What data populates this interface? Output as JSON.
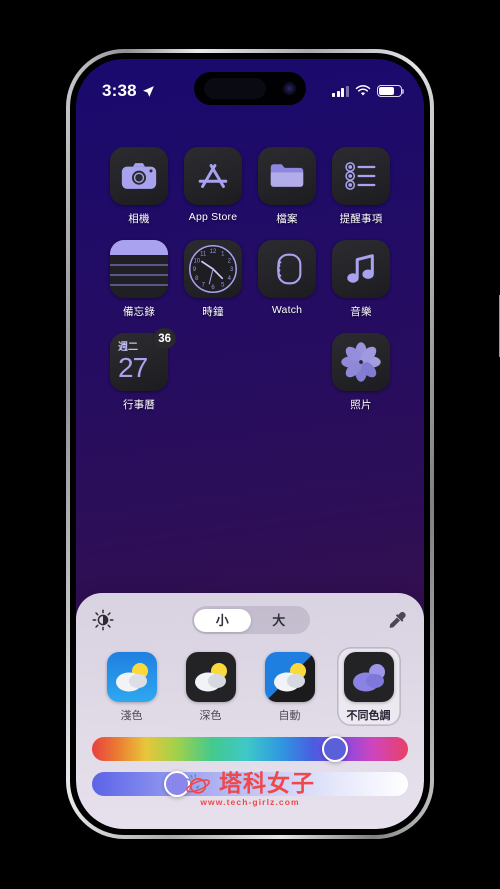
{
  "status_bar": {
    "time": "3:38",
    "location_icon": "location-arrow-icon",
    "cellular_icon": "signal-bars-icon",
    "wifi_icon": "wifi-icon",
    "battery_icon": "battery-icon",
    "battery_level": 72
  },
  "home_screen": {
    "apps": [
      {
        "label": "相機",
        "icon": "camera-icon"
      },
      {
        "label": "App Store",
        "icon": "app-store-icon"
      },
      {
        "label": "檔案",
        "icon": "files-folder-icon"
      },
      {
        "label": "提醒事項",
        "icon": "reminders-icon"
      },
      {
        "label": "備忘錄",
        "icon": "notes-icon"
      },
      {
        "label": "時鐘",
        "icon": "clock-icon"
      },
      {
        "label": "Watch",
        "icon": "watch-icon"
      },
      {
        "label": "音樂",
        "icon": "music-note-icon"
      },
      {
        "label": "行事曆",
        "icon": "calendar-icon",
        "day_of_week": "週二",
        "day_number": "27",
        "badge": "36"
      },
      {
        "label": "",
        "icon": ""
      },
      {
        "label": "",
        "icon": ""
      },
      {
        "label": "照片",
        "icon": "photos-icon"
      }
    ]
  },
  "customize_panel": {
    "brightness_icon": "brightness-half-icon",
    "eyedropper_icon": "eyedropper-icon",
    "size_segments": [
      {
        "label": "小",
        "selected": true
      },
      {
        "label": "大",
        "selected": false
      }
    ],
    "appearance_options": [
      {
        "label": "淺色",
        "icon": "weather-light-icon",
        "selected": false
      },
      {
        "label": "深色",
        "icon": "weather-dark-icon",
        "selected": false
      },
      {
        "label": "自動",
        "icon": "weather-auto-icon",
        "selected": false
      },
      {
        "label": "不同色調",
        "icon": "weather-tinted-icon",
        "selected": true
      }
    ],
    "hue_slider": {
      "name": "hue-slider",
      "value_percent": 77,
      "thumb_color": "#5b5fd8"
    },
    "tint_slider": {
      "name": "saturation-slider",
      "value_percent": 27,
      "thumb_color": "#8a86ec"
    }
  },
  "watermark": {
    "title": "塔科女子",
    "url": "www.tech-girlz.com",
    "accent_color": "#f0484a"
  },
  "colors": {
    "wallpaper_top": "#190a6e",
    "wallpaper_bottom": "#3b1146",
    "panel_bg": "#e2dce8",
    "icon_tint": "#a9a3ef"
  }
}
